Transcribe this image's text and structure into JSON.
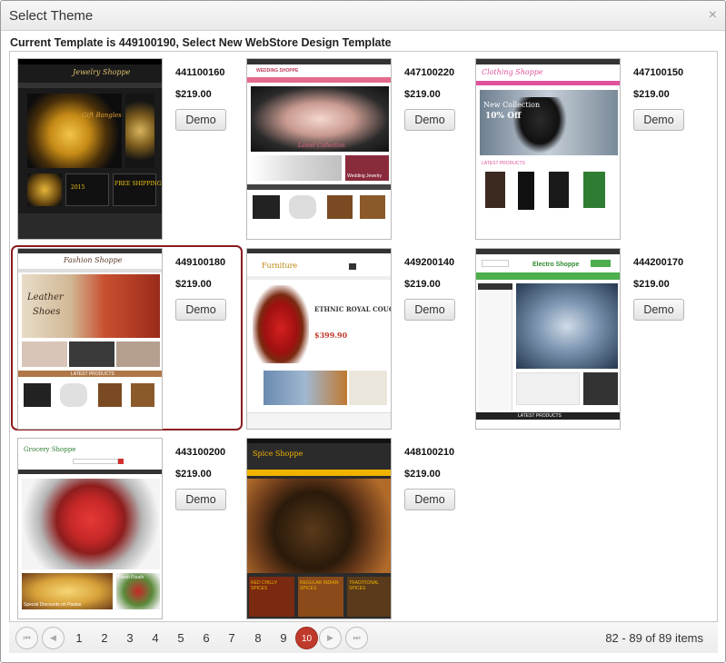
{
  "dialog": {
    "title": "Select Theme",
    "close_glyph": "×"
  },
  "subtitle": "Current Template is 449100190, Select New WebStore Design Template",
  "demo_label": "Demo",
  "templates": [
    {
      "code": "441100160",
      "price": "$219.00",
      "theme": "jewelry",
      "logo": "Jewelry Shoppe",
      "selected": false
    },
    {
      "code": "447100220",
      "price": "$219.00",
      "theme": "wedding",
      "logo": "WEDDING SHOPPE",
      "selected": false
    },
    {
      "code": "447100150",
      "price": "$219.00",
      "theme": "clothing",
      "logo": "Clothing Shoppe",
      "selected": false
    },
    {
      "code": "449100180",
      "price": "$219.00",
      "theme": "fashion",
      "logo": "Fashion Shoppe",
      "selected": true
    },
    {
      "code": "449200140",
      "price": "$219.00",
      "theme": "furniture",
      "logo": "Furniture",
      "selected": false
    },
    {
      "code": "444200170",
      "price": "$219.00",
      "theme": "electro",
      "logo": "Electro Shoppe",
      "selected": false
    },
    {
      "code": "443100200",
      "price": "$219.00",
      "theme": "grocery",
      "logo": "Grocery Shoppe",
      "selected": false
    },
    {
      "code": "448100210",
      "price": "$219.00",
      "theme": "spice",
      "logo": "Spice Shoppe",
      "selected": false
    }
  ],
  "thumb_text": {
    "jewelry_hero": "Gift Bangles",
    "jewelry_promo": "FREE SHIPPING",
    "jewelry_year": "2015",
    "wedding_hero": "Latest Collection",
    "wedding_banner": "Wedding Jewelry",
    "clothing_hero": "New Collection",
    "clothing_sale": "10% Off",
    "clothing_latest": "LATEST PRODUCTS",
    "fashion_hero1": "Leather",
    "fashion_hero2": "Shoes",
    "fashion_latest": "LATEST PRODUCTS",
    "furniture_hero": "ETHNIC ROYAL COUCH",
    "furniture_price": "$399.90",
    "electro_latest": "LATEST PRODUCTS",
    "grocery_promo": "Special Discounts on Pastas",
    "grocery_fresh": "Fresh Foods",
    "spice_tile1": "RED CHILLY SPICES",
    "spice_tile2": "REGULAR INDIAN SPICES",
    "spice_tile3": "TRADITIONAL SPICES"
  },
  "pager": {
    "first_glyph": "⏮",
    "prev_glyph": "◀",
    "next_glyph": "▶",
    "last_glyph": "⏭",
    "pages": [
      "1",
      "2",
      "3",
      "4",
      "5",
      "6",
      "7",
      "8",
      "9",
      "10"
    ],
    "current_page": "10",
    "info": "82 - 89 of 89 items"
  },
  "colors": {
    "selected_border": "#8a1c1c",
    "active_page": "#c0392b",
    "electro_green": "#4cae4c",
    "spice_yellow": "#f0b400",
    "clothing_pink": "#e0529c",
    "wedding_pink": "#e36a8a"
  }
}
